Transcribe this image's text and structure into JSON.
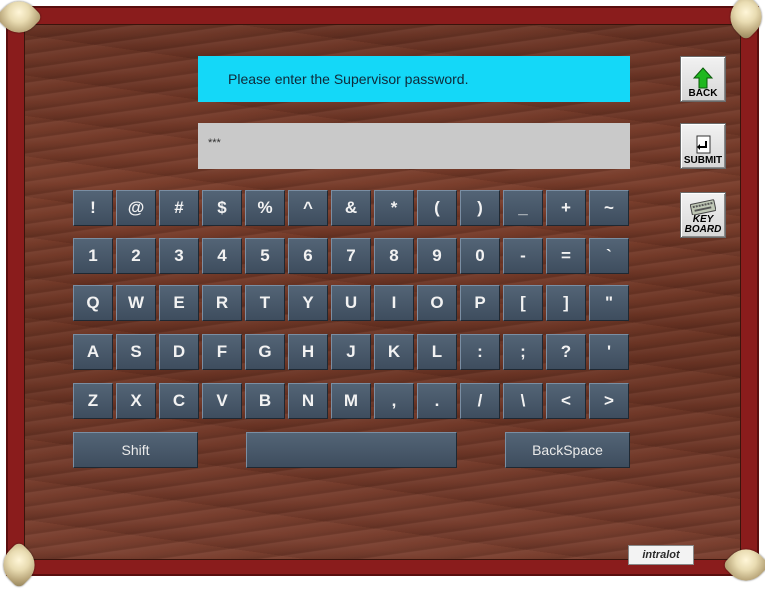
{
  "prompt": "Please enter the Supervisor password.",
  "password_display": "***",
  "sidebar": {
    "back_label": "BACK",
    "submit_label": "SUBMIT",
    "keyboard_label_1": "KEY",
    "keyboard_label_2": "BOARD"
  },
  "keyboard": {
    "row1": [
      "!",
      "@",
      "#",
      "$",
      "%",
      "^",
      "&",
      "*",
      "(",
      ")",
      "_",
      "+",
      "~"
    ],
    "row2": [
      "1",
      "2",
      "3",
      "4",
      "5",
      "6",
      "7",
      "8",
      "9",
      "0",
      "-",
      "=",
      "`"
    ],
    "row3": [
      "Q",
      "W",
      "E",
      "R",
      "T",
      "Y",
      "U",
      "I",
      "O",
      "P",
      "[",
      "]",
      "\""
    ],
    "row4": [
      "A",
      "S",
      "D",
      "F",
      "G",
      "H",
      "J",
      "K",
      "L",
      ":",
      ";",
      "?",
      "'"
    ],
    "row5": [
      "Z",
      "X",
      "C",
      "V",
      "B",
      "N",
      "M",
      ",",
      ".",
      "/",
      "\\",
      "<",
      ">"
    ],
    "shift_label": "Shift",
    "space_label": "",
    "backspace_label": "BackSpace"
  },
  "logo_text": "intralot",
  "colors": {
    "frame": "#8a1c1c",
    "prompt_bg": "#14d8f8",
    "input_bg": "#c9c9c9",
    "key_bg": "#46576a"
  }
}
